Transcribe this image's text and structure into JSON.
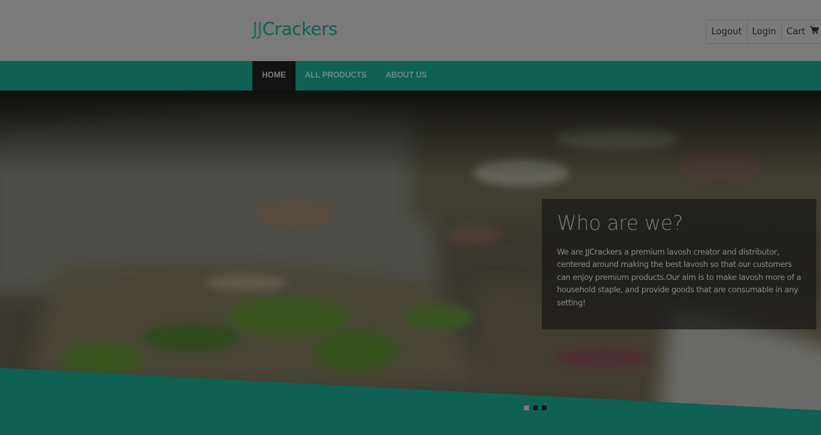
{
  "brand": {
    "prefix": "JJ",
    "name": "Crackers"
  },
  "account": {
    "logout_label": "Logout",
    "login_label": "Login",
    "cart_label": "Cart",
    "cart_icon": "shopping-cart-icon"
  },
  "nav": {
    "items": [
      {
        "label": "HOME",
        "active": true
      },
      {
        "label": "ALL PRODUCTS",
        "active": false
      },
      {
        "label": "ABOUT US",
        "active": false
      }
    ]
  },
  "hero": {
    "heading": "Who are we?",
    "body": "We are JJCrackers a premium lavosh creator and distributor, centered around making the best lavosh so that our customers can enjoy premium products.Our aim is to make lavosh more of a household staple, and provide goods that are consumable in any setting!"
  },
  "carousel": {
    "slide_count": 3,
    "active_index": 0
  },
  "colors": {
    "brand_teal": "#0e6153",
    "overlay": "#7a7a7a"
  }
}
